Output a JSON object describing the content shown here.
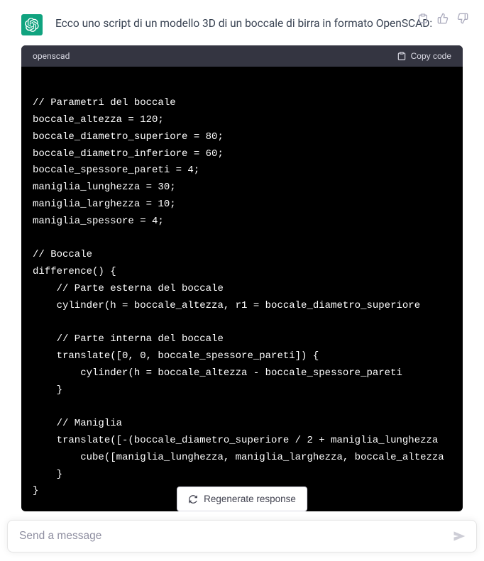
{
  "message": {
    "intro": "Ecco uno script di un modello 3D di un boccale di birra in formato OpenSCAD:"
  },
  "code": {
    "language": "openscad",
    "copy_label": "Copy code",
    "content": "\n// Parametri del boccale\nboccale_altezza = 120;\nboccale_diametro_superiore = 80;\nboccale_diametro_inferiore = 60;\nboccale_spessore_pareti = 4;\nmaniglia_lunghezza = 30;\nmaniglia_larghezza = 10;\nmaniglia_spessore = 4;\n\n// Boccale\ndifference() {\n    // Parte esterna del boccale\n    cylinder(h = boccale_altezza, r1 = boccale_diametro_superiore\n\n    // Parte interna del boccale\n    translate([0, 0, boccale_spessore_pareti]) {\n        cylinder(h = boccale_altezza - boccale_spessore_pareti\n    }\n\n    // Maniglia\n    translate([-(boccale_diametro_superiore / 2 + maniglia_lunghezza\n        cube([maniglia_lunghezza, maniglia_larghezza, boccale_altezza\n    }\n}"
  },
  "regenerate": {
    "label": "Regenerate response"
  },
  "input": {
    "placeholder": "Send a message"
  }
}
